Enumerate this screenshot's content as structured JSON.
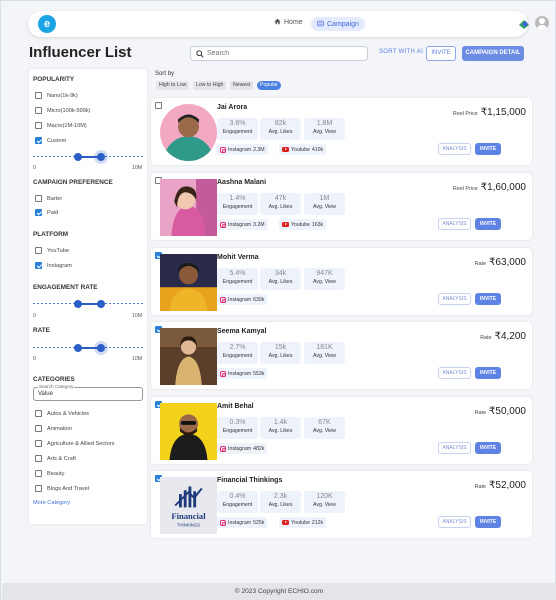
{
  "nav": {
    "logo": "e",
    "home_label": "Home",
    "campaign_label": "Campaign"
  },
  "page": {
    "title": "Influencer List",
    "search_placeholder": "Search",
    "sort_with_ai_label": "SORT WITH AI",
    "invite_label": "INVITE",
    "campaign_detail_label": "CAMPAIGN DETAIL"
  },
  "filters": {
    "popularity": {
      "heading": "POPULARITY",
      "options": [
        {
          "label": "Nano(1k-9k)",
          "checked": false
        },
        {
          "label": "Micro(100k-999k)",
          "checked": false
        },
        {
          "label": "Macro(1M-10M)",
          "checked": false
        },
        {
          "label": "Custom",
          "checked": true
        }
      ],
      "range_min_label": "0",
      "range_max_label": "10M"
    },
    "campaign_preference": {
      "heading": "CAMPAIGN PREFERENCE",
      "options": [
        {
          "label": "Barter",
          "checked": false
        },
        {
          "label": "Paid",
          "checked": true
        }
      ]
    },
    "platform": {
      "heading": "PLATFORM",
      "options": [
        {
          "label": "YouTube",
          "checked": false
        },
        {
          "label": "Instagram",
          "checked": true
        }
      ]
    },
    "engagement_rate": {
      "heading": "ENGAGEMENT RATE",
      "range_min_label": "0",
      "range_max_label": "10M"
    },
    "rate": {
      "heading": "RATE",
      "range_min_label": "0",
      "range_max_label": "10M"
    },
    "categories": {
      "heading": "CATEGORIES",
      "search_label": "Search Category",
      "search_value": "Value",
      "options": [
        {
          "label": "Autos & Vehicles",
          "checked": false
        },
        {
          "label": "Animation",
          "checked": false
        },
        {
          "label": "Agriculture & Allied Sectors",
          "checked": false
        },
        {
          "label": "Arts & Craft",
          "checked": false
        },
        {
          "label": "Beauty",
          "checked": false
        },
        {
          "label": "Blogs And Travel",
          "checked": false
        }
      ],
      "more_label": "More Category"
    }
  },
  "sort": {
    "label": "Sort by",
    "options": [
      "High to Low",
      "Low to High",
      "Newest",
      "Popular"
    ],
    "active": "Popular"
  },
  "influencers": [
    {
      "name": "Jai Arora",
      "checked": false,
      "engagement": "3.6%",
      "avg_likes": "82k",
      "avg_view": "1.8M",
      "instagram": "2.3M",
      "youtube": "410k",
      "price_label": "Reel Price",
      "price": "₹1,15,000"
    },
    {
      "name": "Aashna Malani",
      "checked": false,
      "engagement": "1.4%",
      "avg_likes": "47k",
      "avg_view": "1M",
      "instagram": "3.2M",
      "youtube": "163k",
      "price_label": "Reel Price",
      "price": "₹1,60,000"
    },
    {
      "name": "Mohit Verma",
      "checked": true,
      "engagement": "5.4%",
      "avg_likes": "34k",
      "avg_view": "947K",
      "instagram": "639k",
      "youtube": "",
      "price_label": "Rate",
      "price": "₹63,000"
    },
    {
      "name": "Seema Kamyal",
      "checked": true,
      "engagement": "2.7%",
      "avg_likes": "15k",
      "avg_view": "181K",
      "instagram": "553k",
      "youtube": "",
      "price_label": "Rate",
      "price": "₹4,200"
    },
    {
      "name": "Amit Behal",
      "checked": true,
      "engagement": "0.3%",
      "avg_likes": "1.4k",
      "avg_view": "67K",
      "instagram": "482k",
      "youtube": "",
      "price_label": "Rate",
      "price": "₹50,000"
    },
    {
      "name": "Financial Thinkings",
      "checked": true,
      "engagement": "0.4%",
      "avg_likes": "2.3k",
      "avg_view": "120K",
      "instagram": "525k",
      "youtube": "212k",
      "price_label": "Rate",
      "price": "₹52,000",
      "logo_text_1": "Financial",
      "logo_text_2": "THINKINGS"
    }
  ],
  "labels": {
    "engagement": "Engagement",
    "avg_likes": "Avg. Likes",
    "avg_view": "Avg. View",
    "instagram": "Instagram",
    "youtube": "Youtube",
    "analysis": "ANALYSIS",
    "invite": "INVITE"
  },
  "footer": {
    "text": "© 2023 Copyright ECHIO.com"
  },
  "colors": {
    "accent": "#5f83e3",
    "check": "#2a7fd9",
    "slider": "#2c5ec8"
  }
}
